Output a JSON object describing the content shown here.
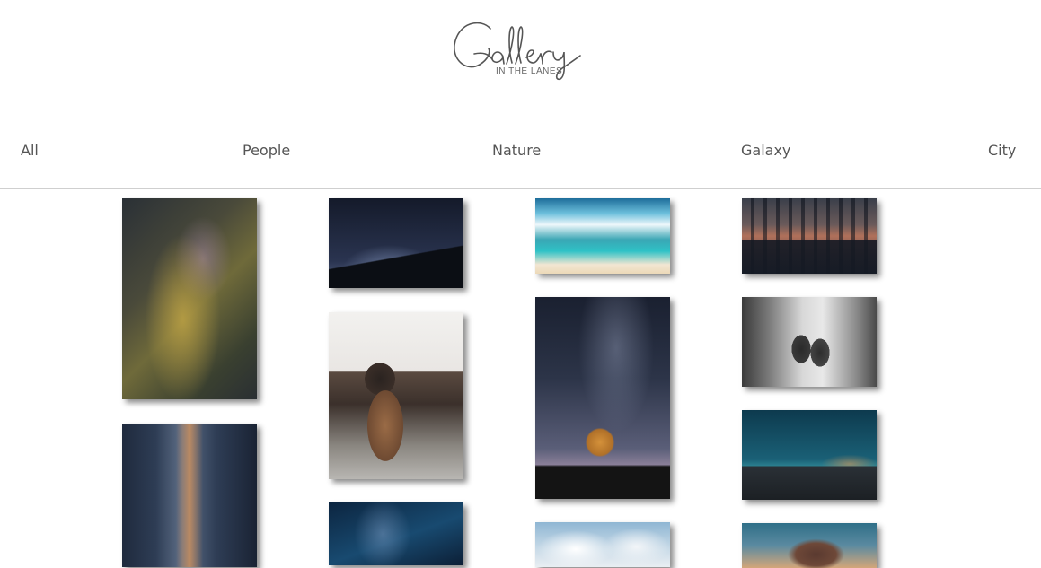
{
  "logo": {
    "title": "Gallery",
    "subtitle": "IN THE LANES"
  },
  "nav": {
    "items": [
      "All",
      "People",
      "Nature",
      "Galaxy",
      "City"
    ]
  },
  "photos": [
    {
      "subject": "milky-way-galaxy"
    },
    {
      "subject": "city-street-skyscrapers"
    },
    {
      "subject": "silhouette-under-stars"
    },
    {
      "subject": "hiker-with-backpack"
    },
    {
      "subject": "starry-night-sky"
    },
    {
      "subject": "tropical-beach-sky"
    },
    {
      "subject": "lone-tree-under-milky-way"
    },
    {
      "subject": "clouds-and-landscape"
    },
    {
      "subject": "city-skyline-dusk"
    },
    {
      "subject": "children-walking-black-white"
    },
    {
      "subject": "night-sky-over-mountains"
    },
    {
      "subject": "tree-at-sunset"
    }
  ]
}
